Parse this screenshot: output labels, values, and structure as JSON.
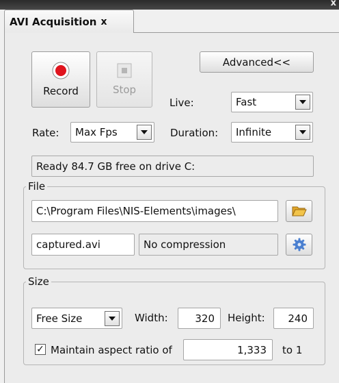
{
  "tab": {
    "title": "AVI Acquisition",
    "close": "x"
  },
  "window": {
    "close": "x"
  },
  "controls": {
    "record_label": "Record",
    "stop_label": "Stop",
    "advanced_label": "Advanced<<",
    "live_label": "Live:",
    "live_value": "Fast",
    "rate_label": "Rate:",
    "rate_value": "Max Fps",
    "duration_label": "Duration:",
    "duration_value": "Infinite",
    "status": "Ready 84.7 GB free on drive C:"
  },
  "file": {
    "legend": "File",
    "path": "C:\\Program Files\\NIS-Elements\\images\\",
    "filename": "captured.avi",
    "compression": "No compression"
  },
  "size": {
    "legend": "Size",
    "mode": "Free Size",
    "width_label": "Width:",
    "width": "320",
    "height_label": "Height:",
    "height": "240",
    "aspect_label": "Maintain aspect ratio of",
    "aspect_checked": true,
    "aspect_value": "1,333",
    "to_label": "to 1"
  },
  "colors": {
    "record_red": "#e0141e",
    "folder_yellow": "#f2c44a",
    "gear_blue": "#4a7fd0"
  }
}
